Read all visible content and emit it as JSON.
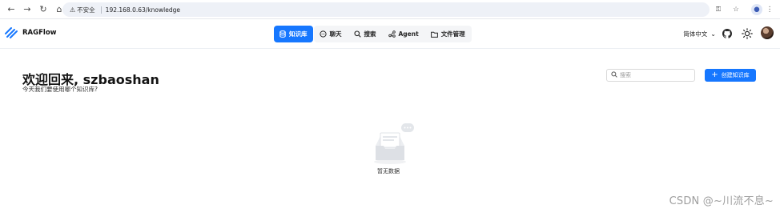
{
  "browser": {
    "security_label": "不安全",
    "url": "192.168.0.63/knowledge",
    "icons": [
      "back-icon",
      "forward-icon",
      "reload-icon",
      "home-icon",
      "warning-icon",
      "key-icon",
      "star-icon",
      "profile-icon",
      "more-icon"
    ]
  },
  "app": {
    "logo_text": "RAGFlow",
    "tabs": [
      {
        "label": "知识库",
        "icon": "database-icon",
        "active": true
      },
      {
        "label": "聊天",
        "icon": "chat-icon",
        "active": false
      },
      {
        "label": "搜索",
        "icon": "search-icon",
        "active": false
      },
      {
        "label": "Agent",
        "icon": "agent-icon",
        "active": false
      },
      {
        "label": "文件管理",
        "icon": "folder-icon",
        "active": false
      }
    ],
    "language": "简体中文",
    "accent_color": "#1677ff"
  },
  "main": {
    "welcome": "欢迎回来, szbaoshan",
    "subtitle": "今天我们要使用哪个知识库?",
    "search_placeholder": "搜索",
    "create_button": "创建知识库",
    "empty_text": "暂无数据"
  },
  "watermark": "CSDN @~川流不息~"
}
